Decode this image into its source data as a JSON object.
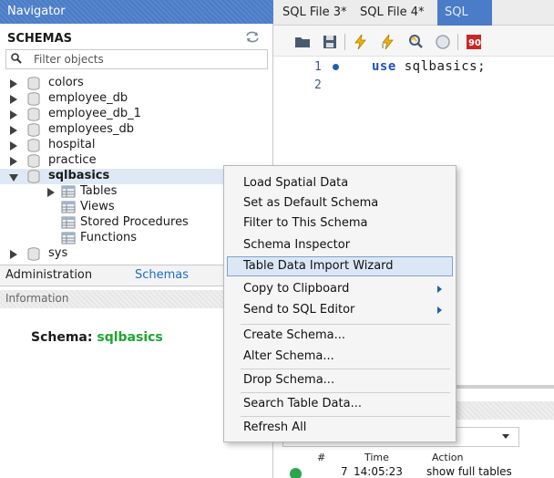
{
  "navigator": {
    "title": "Navigator",
    "schemas_title": "SCHEMAS",
    "filter_placeholder": "Filter objects",
    "schemas": [
      {
        "label": "colors"
      },
      {
        "label": "employee_db"
      },
      {
        "label": "employee_db_1"
      },
      {
        "label": "employees_db"
      },
      {
        "label": "hospital"
      },
      {
        "label": "practice"
      },
      {
        "label": "sqlbasics",
        "expanded": true,
        "selected": true
      },
      {
        "label": "sys"
      }
    ],
    "sqlbasics_children": [
      "Tables",
      "Views",
      "Stored Procedures",
      "Functions"
    ],
    "bottom_tabs": [
      "Administration",
      "Schemas"
    ],
    "info_title": "Information",
    "schema_info_label": "Schema:",
    "schema_info_value": "sqlbasics"
  },
  "editor": {
    "tabs": [
      "SQL File 3*",
      "SQL File 4*",
      "SQL"
    ],
    "line_numbers": [
      "1",
      "2"
    ],
    "code_keyword": "use",
    "code_rest": " sqlbasics;"
  },
  "context_menu": {
    "items": [
      {
        "label": "Load Spatial Data"
      },
      {
        "label": "Set as Default Schema"
      },
      {
        "label": "Filter to This Schema"
      },
      {
        "label": "Schema Inspector"
      },
      {
        "label": "Table Data Import Wizard",
        "highlighted": true
      },
      {
        "label": "Copy to Clipboard",
        "submenu": true
      },
      {
        "label": "Send to SQL Editor",
        "submenu": true
      },
      {
        "label": "Create Schema..."
      },
      {
        "label": "Alter Schema..."
      },
      {
        "label": "Drop Schema..."
      },
      {
        "label": "Search Table Data..."
      },
      {
        "label": "Refresh All"
      }
    ]
  },
  "output": {
    "columns": [
      "#",
      "Time",
      "Action"
    ],
    "rows": [
      {
        "num": "7",
        "time": "14:05:23",
        "action": "show full tables"
      }
    ]
  },
  "colors": {
    "accent": "#4a7cc7",
    "keyword": "#1e4fc2",
    "schema_value": "#1fa52f",
    "success": "#2da44e"
  }
}
